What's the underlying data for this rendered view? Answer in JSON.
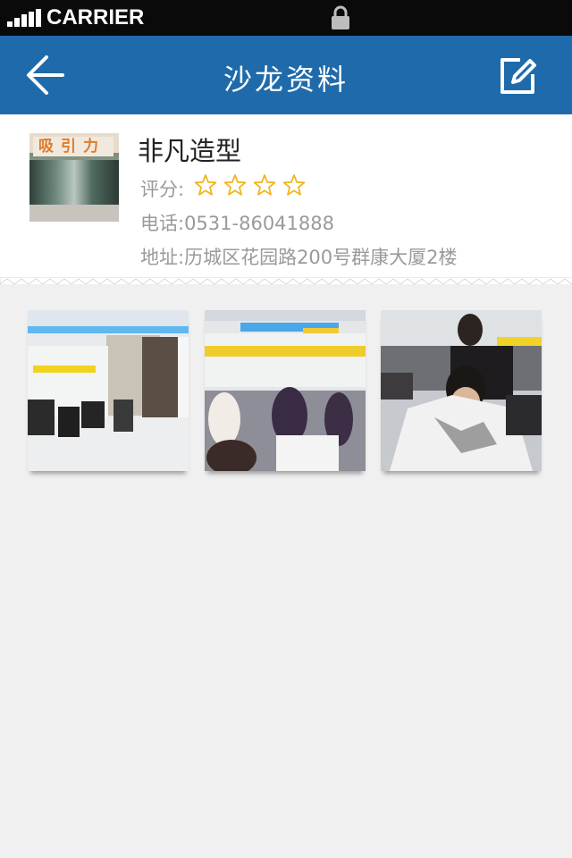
{
  "status_bar": {
    "carrier": "CARRIER"
  },
  "nav": {
    "title": "沙龙资料",
    "back_icon": "back-arrow-icon",
    "edit_icon": "edit-icon"
  },
  "salon": {
    "name": "非凡造型",
    "thumbnail_sign": "吸引力",
    "rating_label": "评分:",
    "rating_stars": 4,
    "phone": "电话:0531-86041888",
    "address": "地址:历城区花园路200号群康大厦2楼"
  },
  "colors": {
    "nav_background": "#1f6aaa",
    "star": "#f2b51f",
    "status_bar": "#0a0a0a"
  },
  "photos": [
    {
      "scene": "salon-interior-empty"
    },
    {
      "scene": "salon-stylists-working"
    },
    {
      "scene": "haircut-in-progress"
    }
  ]
}
